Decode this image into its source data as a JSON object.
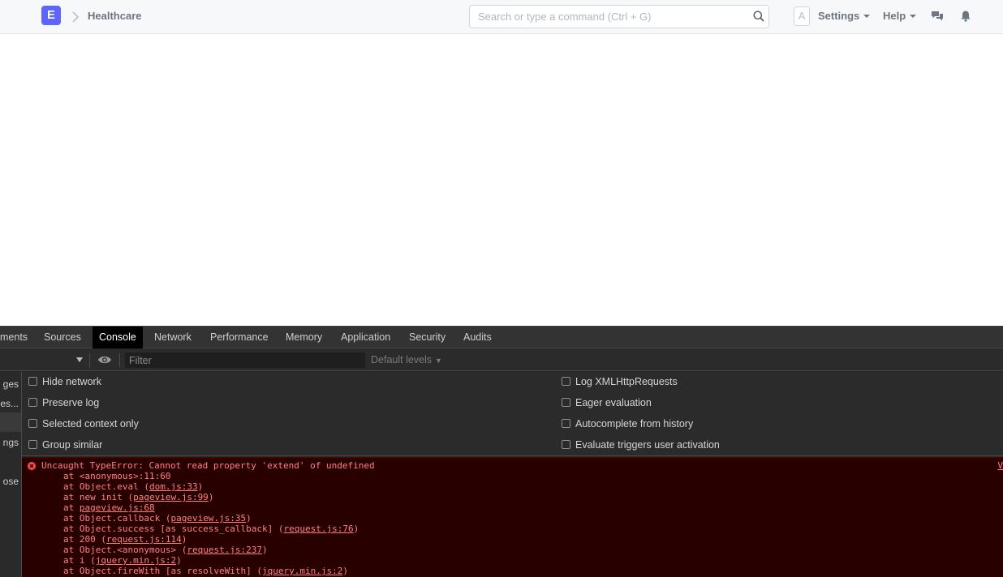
{
  "navbar": {
    "logo_letter": "E",
    "breadcrumb": "Healthcare",
    "search_placeholder": "Search or type a command (Ctrl + G)",
    "avatar_letter": "A",
    "settings_label": "Settings",
    "help_label": "Help"
  },
  "devtools": {
    "tabs": [
      "ments",
      "Sources",
      "Console",
      "Network",
      "Performance",
      "Memory",
      "Application",
      "Security",
      "Audits"
    ],
    "active_tab": "Console",
    "filter_placeholder": "Filter",
    "levels_label": "Default levels",
    "sidebar_items": [
      "ges",
      "es...",
      "ngs",
      "ose"
    ],
    "settings_left": [
      "Hide network",
      "Preserve log",
      "Selected context only",
      "Group similar"
    ],
    "settings_right": [
      "Log XMLHttpRequests",
      "Eager evaluation",
      "Autocomplete from history",
      "Evaluate triggers user activation"
    ],
    "error": {
      "message": "Uncaught TypeError: Cannot read property 'extend' of undefined",
      "source_link": "V",
      "trace": [
        {
          "pre": "at <anonymous>:11:60",
          "link": "",
          "post": ""
        },
        {
          "pre": "at Object.eval (",
          "link": "dom.js:33",
          "post": ")"
        },
        {
          "pre": "at new init (",
          "link": "pageview.js:99",
          "post": ")"
        },
        {
          "pre": "at ",
          "link": "pageview.js:68",
          "post": ""
        },
        {
          "pre": "at Object.callback (",
          "link": "pageview.js:35",
          "post": ")"
        },
        {
          "pre": "at Object.success [as success_callback] (",
          "link": "request.js:76",
          "post": ")"
        },
        {
          "pre": "at 200 (",
          "link": "request.js:114",
          "post": ")"
        },
        {
          "pre": "at Object.<anonymous> (",
          "link": "request.js:237",
          "post": ")"
        },
        {
          "pre": "at i (",
          "link": "jquery.min.js:2",
          "post": ")"
        },
        {
          "pre": "at Object.fireWith [as resolveWith] (",
          "link": "jquery.min.js:2",
          "post": ")"
        }
      ]
    }
  },
  "colors": {
    "brand": "#5e64ff",
    "error_bg": "#290000",
    "error_text": "#ff8080"
  }
}
